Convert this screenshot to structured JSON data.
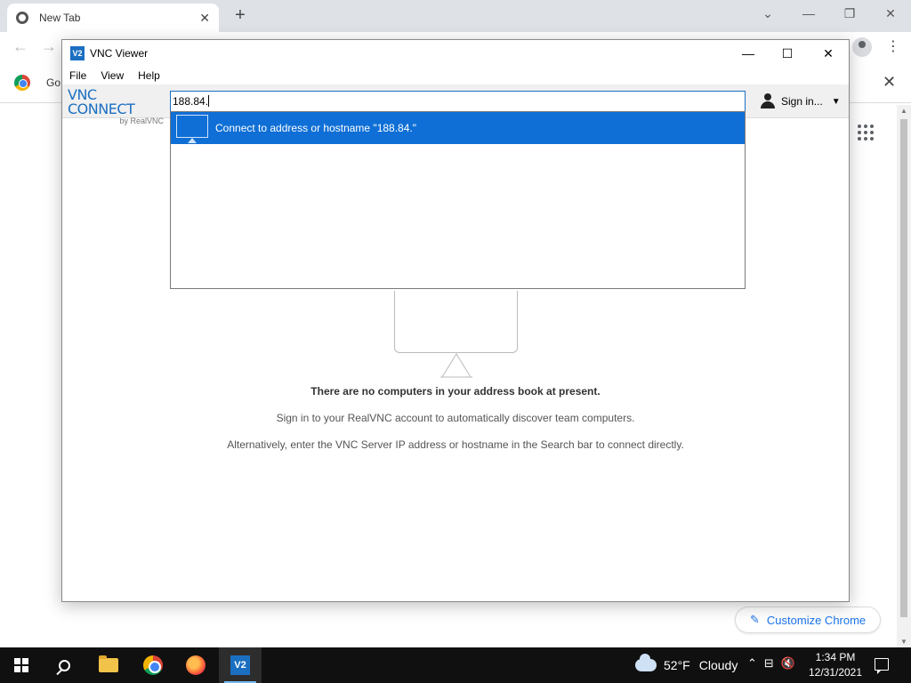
{
  "browser": {
    "tab_title": "New Tab",
    "tab_close": "✕",
    "new_tab": "+",
    "bookmark_label": "Go",
    "bookmark_close": "✕",
    "customize_label": "Customize Chrome",
    "window_controls": {
      "chevron": "⌄",
      "minimize": "—",
      "restore": "❐",
      "close": "✕"
    }
  },
  "vnc": {
    "window_title": "VNC Viewer",
    "window_controls": {
      "minimize": "—",
      "maximize": "☐",
      "close": "✕"
    },
    "menu": [
      "File",
      "View",
      "Help"
    ],
    "logo_main": "VNC CONNECT",
    "logo_sub": "by RealVNC",
    "search_value": "188.84.",
    "signin_label": "Sign in...",
    "suggestion_text": "Connect to address or hostname \"188.84.\"",
    "empty_heading": "There are no computers in your address book at present.",
    "empty_line1": "Sign in to your RealVNC account to automatically discover team computers.",
    "empty_line2": "Alternatively, enter the VNC Server IP address or hostname in the Search bar to connect directly."
  },
  "taskbar": {
    "weather_temp": "52°F",
    "weather_text": "Cloudy",
    "clock_time": "1:34 PM",
    "clock_date": "12/31/2021",
    "active_app": "vnc-viewer"
  },
  "colors": {
    "vnc_accent": "#1b6fc1",
    "selection": "#0f6fd6",
    "chrome_link": "#1a73e8"
  }
}
